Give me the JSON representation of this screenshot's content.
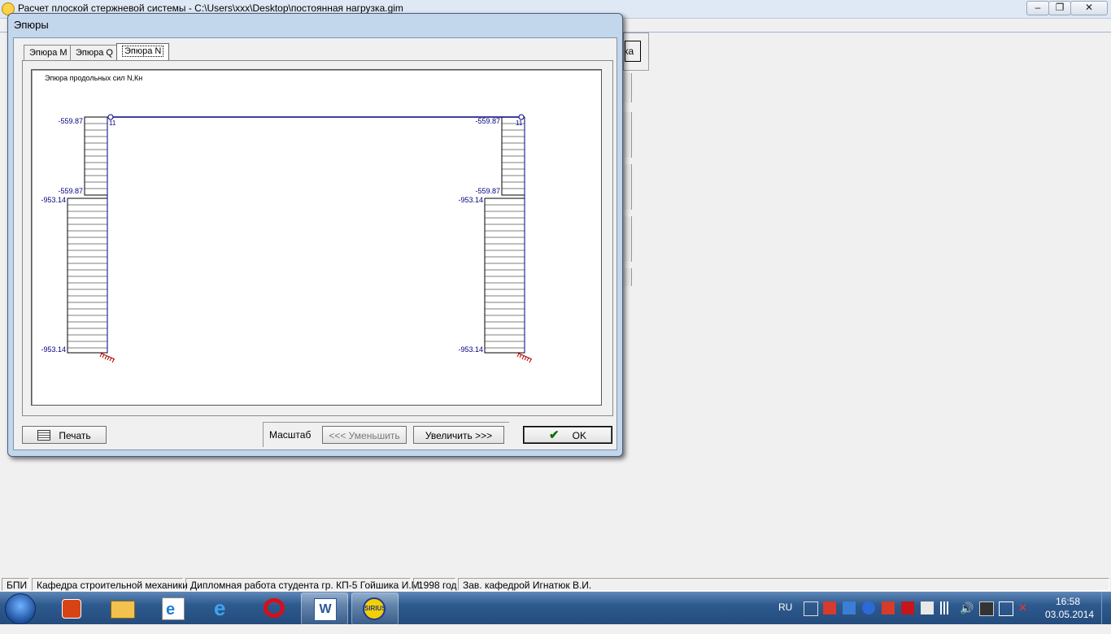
{
  "main_window": {
    "title": "Расчет плоской стержневой системы - C:\\Users\\xxx\\Desktop\\постоянная нагрузка.gim",
    "partial_button_text": "ка"
  },
  "dialog": {
    "title": "Эпюры",
    "tabs": [
      {
        "label": "Эпюра M",
        "active": false
      },
      {
        "label": "Эпюра Q",
        "active": false
      },
      {
        "label": "Эпюра N",
        "active": true
      }
    ],
    "plot": {
      "title": "Эпюра продольных сил N,Кн",
      "node_label": "11",
      "labels": {
        "left_top_1": "-559.87",
        "left_top_2": "-559.87",
        "left_bot_1": "-953.14",
        "left_bot_2": "-953.14",
        "right_top_1": "-559.87",
        "right_top_2": "-559.87",
        "right_bot_1": "-953.14",
        "right_bot_2": "-953.14"
      },
      "colors": {
        "member": "#000080",
        "hatch": "#000000",
        "support": "#b00000",
        "label": "#000080"
      }
    },
    "buttons": {
      "print": "Печать",
      "scale_label": "Масштаб",
      "decrease": "<<<   Уменьшить",
      "increase": "Увеличить   >>>",
      "ok": "OK"
    }
  },
  "status_bar": {
    "panels": [
      "БПИ",
      "Кафедра строительной механики",
      "Дипломная работа студента гр. КП-5 Гойшика И.М.",
      "1998 год",
      "Зав. кафедрой Игнатюк В.И."
    ]
  },
  "taskbar": {
    "apps": [
      "start-orb",
      "media-player",
      "file-explorer",
      "internet-explorer",
      "internet-explorer",
      "opera",
      "microsoft-word",
      "sirius-app"
    ],
    "language": "RU",
    "time": "16:58",
    "date": "03.05.2014"
  }
}
